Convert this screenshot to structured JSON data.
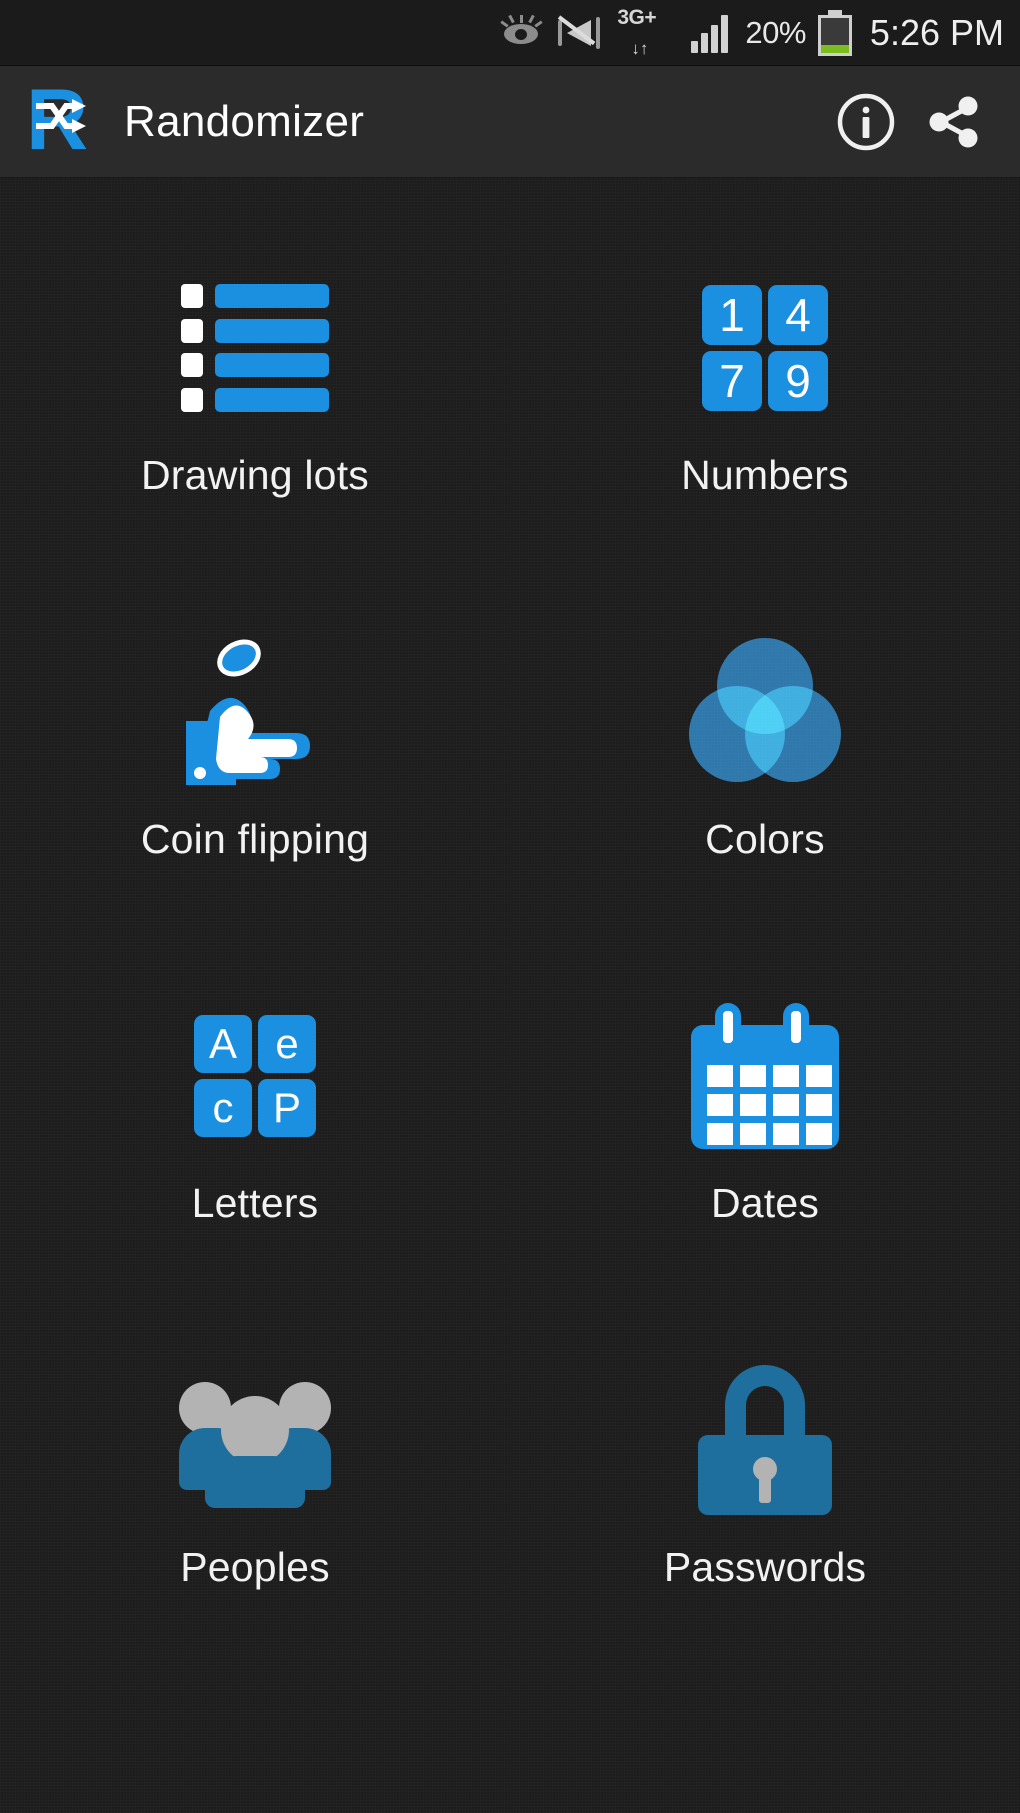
{
  "status_bar": {
    "icons": [
      "smart-stay-eye-icon",
      "mute-vibrate-icon",
      "network-3g-plus-icon",
      "signal-bars-icon"
    ],
    "network_label": "3G+",
    "data_arrows": "↓↑",
    "battery_percent": "20%",
    "battery_level": 20,
    "battery_color": "#7bbd1e",
    "time": "5:26 PM"
  },
  "action_bar": {
    "logo_letter": "R",
    "logo_icon": "shuffle-icon",
    "title": "Randomizer",
    "info_label": "Info",
    "share_label": "Share"
  },
  "colors": {
    "accent": "#1b8fe0",
    "accent_dark": "#1f6f9e",
    "background": "#1d1d1d",
    "action_bar": "#2b2b2b",
    "status_bar": "#1b1b1b",
    "text": "#f2f2f2",
    "gray": "#b3b3b3"
  },
  "grid": {
    "items": [
      {
        "id": "drawing-lots",
        "label": "Drawing lots",
        "icon": "list-icon"
      },
      {
        "id": "numbers",
        "label": "Numbers",
        "icon": "numbers-tiles-icon",
        "tiles": [
          "1",
          "4",
          "7",
          "9"
        ]
      },
      {
        "id": "coin-flipping",
        "label": "Coin flipping",
        "icon": "hand-flipping-coin-icon"
      },
      {
        "id": "colors",
        "label": "Colors",
        "icon": "color-circles-icon"
      },
      {
        "id": "letters",
        "label": "Letters",
        "icon": "letters-tiles-icon",
        "tiles": [
          "A",
          "e",
          "c",
          "P"
        ]
      },
      {
        "id": "dates",
        "label": "Dates",
        "icon": "calendar-icon"
      },
      {
        "id": "peoples",
        "label": "Peoples",
        "icon": "people-group-icon"
      },
      {
        "id": "passwords",
        "label": "Passwords",
        "icon": "lock-icon"
      }
    ]
  }
}
